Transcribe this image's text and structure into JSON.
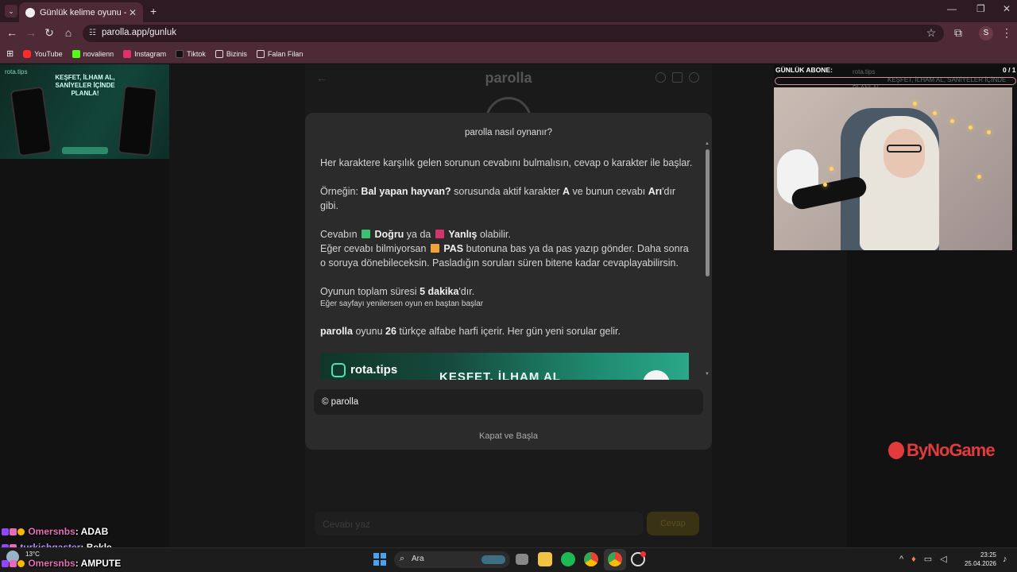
{
  "browser": {
    "tab_title": "Günlük kelime oyunu - parolla",
    "url": "parolla.app/gunluk",
    "profile_initial": "S",
    "bookmarks": [
      {
        "label": "YouTube",
        "color": "#ff2a2a"
      },
      {
        "label": "novalienn",
        "color": "#53fc18"
      },
      {
        "label": "Instagram",
        "color": "#e1306c"
      },
      {
        "label": "Tiktok",
        "color": "#111111"
      },
      {
        "label": "Bizinis",
        "color": "folder"
      },
      {
        "label": "Falan Filan",
        "color": "folder"
      }
    ]
  },
  "ad_left": {
    "brand": "rota.tips",
    "headline": "KEŞFET, İLHAM AL, SANİYELER İÇİNDE PLANLA!"
  },
  "game": {
    "title": "parolla",
    "answer_placeholder": "Cevabı yaz",
    "answer_button": "Cevap"
  },
  "modal": {
    "title": "parolla nasıl oynanır?",
    "intro": "Her karaktere karşılık gelen sorunun cevabını bulmalısın, cevap o karakter ile başlar.",
    "example_prefix": "Örneğin: ",
    "example_question": "Bal yapan hayvan?",
    "example_mid": " sorusunda aktif karakter ",
    "example_letter": "A",
    "example_mid2": " ve bunun cevabı ",
    "example_answer": "Arı",
    "example_suffix": "'dır gibi.",
    "answer_prefix": "Cevabın ",
    "correct_label": "Doğru",
    "or_text": " ya da ",
    "wrong_label": "Yanlış",
    "answer_suffix": " olabilir.",
    "pass_prefix": "Eğer cevabı bilmiyorsan ",
    "pass_label": "PAS",
    "pass_suffix": " butonuna bas ya da pas yazıp gönder. Daha sonra o soruya dönebileceksin. Pasladığın soruları süren bitene kadar cevaplayabilirsin.",
    "time_prefix": "Oyunun toplam süresi ",
    "time_value": "5 dakika",
    "time_suffix": "'dır.",
    "refresh_note": "Eğer sayfayı yenilersen oyun en baştan başlar",
    "letters_brand": "parolla",
    "letters_mid": " oyunu ",
    "letters_count": "26",
    "letters_suffix": " türkçe alfabe harfi içerir. Her gün yeni sorular gelir.",
    "banner_logo": "rota.tips",
    "banner_text": "KEŞFET, İLHAM AL",
    "copyright": "© parolla",
    "close_button": "Kapat ve Başla",
    "colors": {
      "correct": "#3dbf74",
      "wrong": "#d6336c",
      "pass": "#f0a23a"
    }
  },
  "stream": {
    "sub_label": "GÜNLÜK ABONE:",
    "sub_count": "0 / 1",
    "sub_ghost_brand": "rota.tips",
    "sub_ghost_text": "KEŞFET, İLHAM AL, SANİYELER İÇİNDE PLANLA!",
    "sponsor": "ByNoGame"
  },
  "chat": [
    {
      "user": "Omersnbs",
      "message": ": ADAB",
      "user_color": "#e86bb8"
    },
    {
      "user": "turkishgaster",
      "message": ": Bekle",
      "user_color": "#b98ef0"
    },
    {
      "user": "Omersnbs",
      "message": ": AMPUTE",
      "user_color": "#e86bb8"
    }
  ],
  "taskbar": {
    "weather_temp": "13°C",
    "search_placeholder": "Ara",
    "time": "23:25",
    "date": "25.04.2026"
  }
}
